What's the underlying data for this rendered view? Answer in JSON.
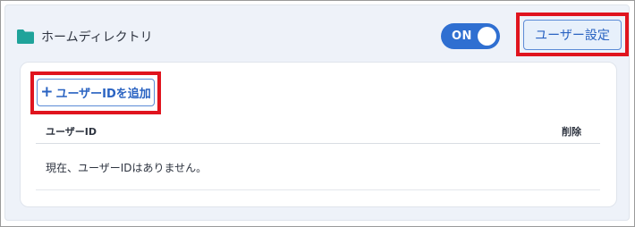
{
  "section": {
    "title": "ホームディレクトリ",
    "icon": "folder-icon",
    "icon_color": "#1fa39a"
  },
  "toggle": {
    "label": "ON",
    "state": "on",
    "color": "#2f6fd1"
  },
  "buttons": {
    "user_settings": "ユーザー設定",
    "add_user_id": "ユーザーIDを追加"
  },
  "table": {
    "columns": [
      "ユーザーID",
      "削除"
    ],
    "empty_message": "現在、ユーザーIDはありません。"
  },
  "highlight_color": "#e0141e"
}
